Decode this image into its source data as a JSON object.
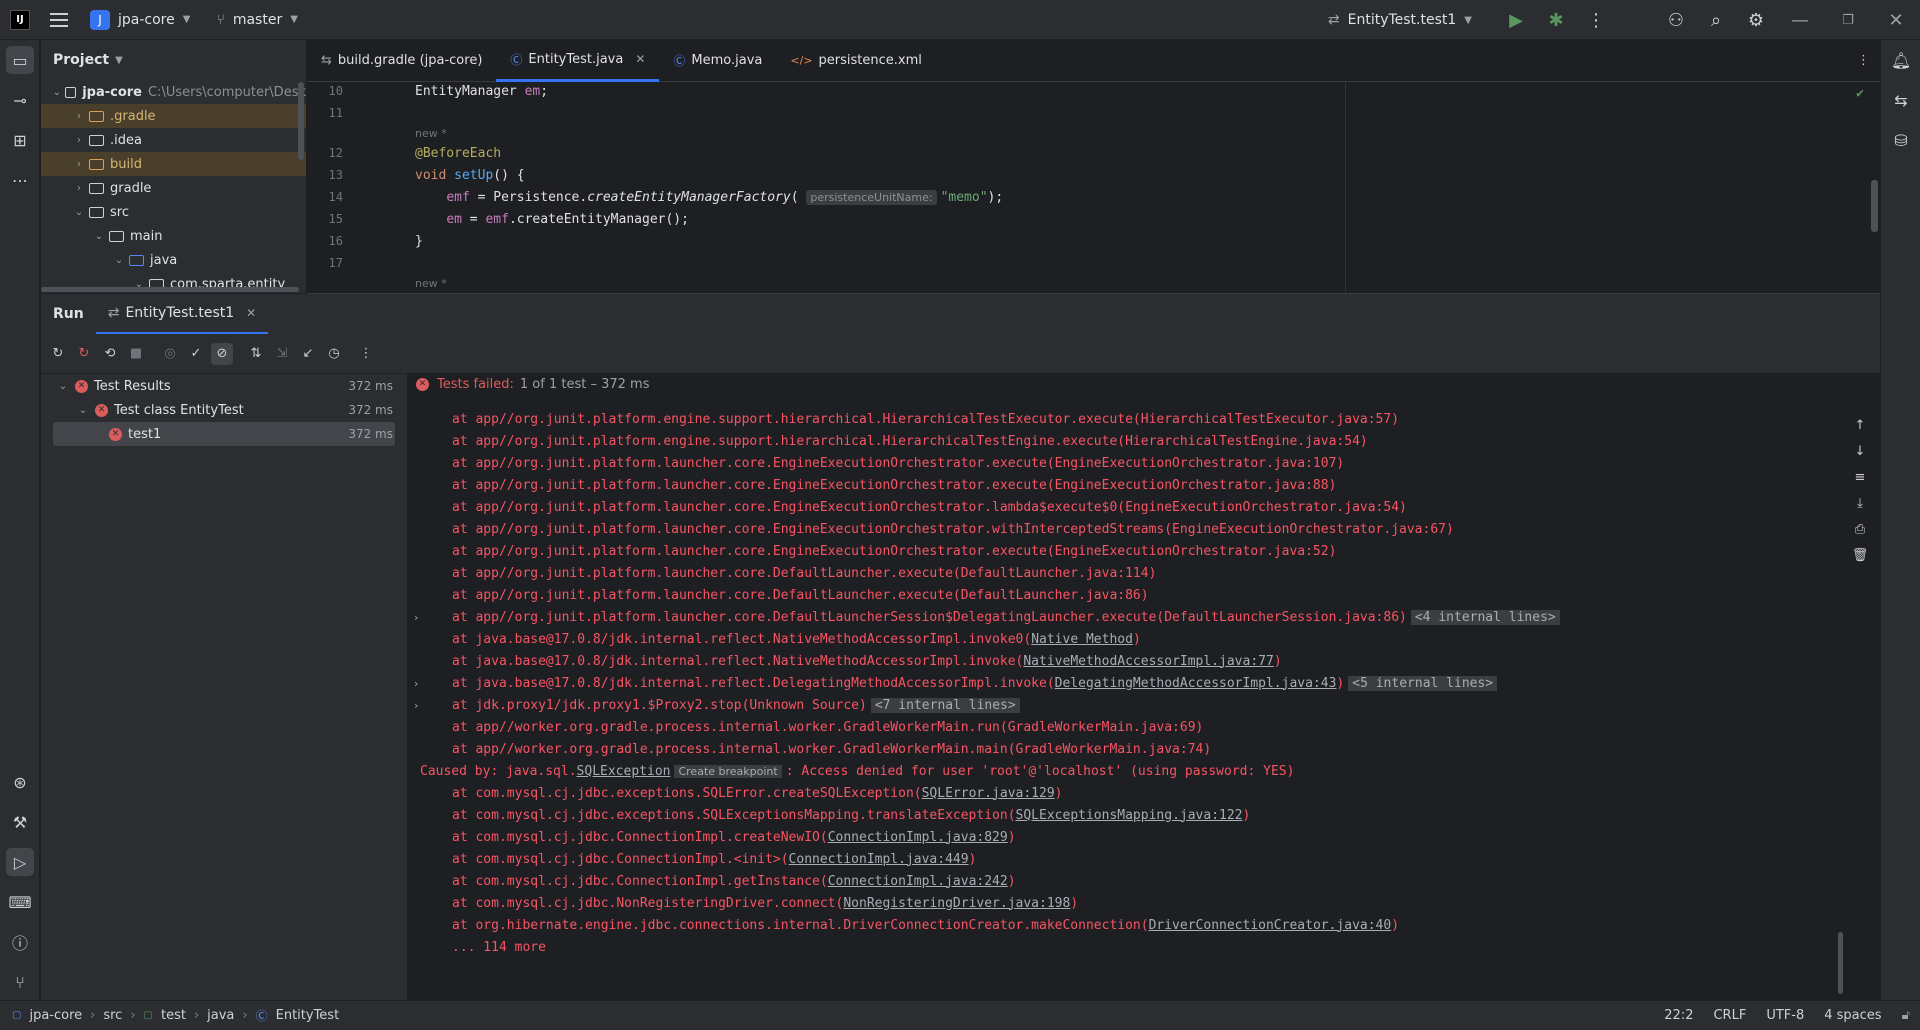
{
  "titlebar": {
    "logo": "IJ",
    "project_badge": "J",
    "project_name": "jpa-core",
    "branch": "master",
    "run_config": "EntityTest.test1"
  },
  "project_panel": {
    "title": "Project",
    "root_name": "jpa-core",
    "root_path": "C:\\Users\\computer\\Desk",
    "items": [
      {
        "label": ".gradle"
      },
      {
        "label": ".idea"
      },
      {
        "label": "build"
      },
      {
        "label": "gradle"
      },
      {
        "label": "src"
      },
      {
        "label": "main"
      },
      {
        "label": "java"
      },
      {
        "label": "com.sparta.entity"
      }
    ]
  },
  "editor_tabs": [
    {
      "label": "build.gradle (jpa-core)"
    },
    {
      "label": "EntityTest.java"
    },
    {
      "label": "Memo.java"
    },
    {
      "label": "persistence.xml"
    }
  ],
  "code": {
    "l10_num": "10",
    "l10_type": "EntityManager",
    "l10_var": "em",
    "l11_num": "11",
    "new_hint": "new *",
    "l12_num": "12",
    "l12_ann": "@BeforeEach",
    "l13_num": "13",
    "l13_kw": "void",
    "l13_fn": "setUp",
    "l14_num": "14",
    "l14_field": "emf",
    "l14_cls": "Persistence",
    "l14_method": "createEntityManagerFactory",
    "l14_hint": "persistenceUnitName:",
    "l14_str": "\"memo\"",
    "l15_num": "15",
    "l15_field": "em",
    "l15_obj": "emf",
    "l15_method": "createEntityManager",
    "l16_num": "16",
    "l17_num": "17"
  },
  "run_panel": {
    "title": "Run",
    "tab": "EntityTest.test1"
  },
  "results": {
    "root": "Test Results",
    "root_ms": "372 ms",
    "cls": "Test class EntityTest",
    "cls_ms": "372 ms",
    "test": "test1",
    "test_ms": "372 ms"
  },
  "console": {
    "status_failed": "Tests failed:",
    "status_detail": "1 of 1 test – 372 ms",
    "l01": "at app//org.junit.platform.engine.support.hierarchical.HierarchicalTestExecutor.execute(HierarchicalTestExecutor.java:57)",
    "l02": "at app//org.junit.platform.engine.support.hierarchical.HierarchicalTestEngine.execute(HierarchicalTestEngine.java:54)",
    "l03": "at app//org.junit.platform.launcher.core.EngineExecutionOrchestrator.execute(EngineExecutionOrchestrator.java:107)",
    "l04": "at app//org.junit.platform.launcher.core.EngineExecutionOrchestrator.execute(EngineExecutionOrchestrator.java:88)",
    "l05": "at app//org.junit.platform.launcher.core.EngineExecutionOrchestrator.lambda$execute$0(EngineExecutionOrchestrator.java:54)",
    "l06": "at app//org.junit.platform.launcher.core.EngineExecutionOrchestrator.withInterceptedStreams(EngineExecutionOrchestrator.java:67)",
    "l07": "at app//org.junit.platform.launcher.core.EngineExecutionOrchestrator.execute(EngineExecutionOrchestrator.java:52)",
    "l08": "at app//org.junit.platform.launcher.core.DefaultLauncher.execute(DefaultLauncher.java:114)",
    "l09": "at app//org.junit.platform.launcher.core.DefaultLauncher.execute(DefaultLauncher.java:86)",
    "l10": "at app//org.junit.platform.launcher.core.DefaultLauncherSession$DelegatingLauncher.execute(DefaultLauncherSession.java:86)",
    "l10_internal": "<4 internal lines>",
    "l11_a": "at java.base@17.0.8/jdk.internal.reflect.NativeMethodAccessorImpl.invoke0(",
    "l11_link": "Native Method",
    "l11_b": ")",
    "l12_a": "at java.base@17.0.8/jdk.internal.reflect.NativeMethodAccessorImpl.invoke(",
    "l12_link": "NativeMethodAccessorImpl.java:77",
    "l12_b": ")",
    "l13_a": "at java.base@17.0.8/jdk.internal.reflect.DelegatingMethodAccessorImpl.invoke(",
    "l13_link": "DelegatingMethodAccessorImpl.java:43",
    "l13_b": ")",
    "l13_internal": "<5 internal lines>",
    "l14": "at jdk.proxy1/jdk.proxy1.$Proxy2.stop(Unknown Source)",
    "l14_internal": "<7 internal lines>",
    "l15": "at app//worker.org.gradle.process.internal.worker.GradleWorkerMain.run(GradleWorkerMain.java:69)",
    "l16": "at app//worker.org.gradle.process.internal.worker.GradleWorkerMain.main(GradleWorkerMain.java:74)",
    "l17_a": "Caused by: java.sql.",
    "l17_link": "SQLException",
    "l17_bp": "Create breakpoint",
    "l17_b": ": Access denied for user 'root'@'localhost' (using password: YES)",
    "l18_a": "at com.mysql.cj.jdbc.exceptions.SQLError.createSQLException(",
    "l18_link": "SQLError.java:129",
    "l18_b": ")",
    "l19_a": "at com.mysql.cj.jdbc.exceptions.SQLExceptionsMapping.translateException(",
    "l19_link": "SQLExceptionsMapping.java:122",
    "l19_b": ")",
    "l20_a": "at com.mysql.cj.jdbc.ConnectionImpl.createNewIO(",
    "l20_link": "ConnectionImpl.java:829",
    "l20_b": ")",
    "l21_a": "at com.mysql.cj.jdbc.ConnectionImpl.<init>(",
    "l21_link": "ConnectionImpl.java:449",
    "l21_b": ")",
    "l22_a": "at com.mysql.cj.jdbc.ConnectionImpl.getInstance(",
    "l22_link": "ConnectionImpl.java:242",
    "l22_b": ")",
    "l23_a": "at com.mysql.cj.jdbc.NonRegisteringDriver.connect(",
    "l23_link": "NonRegisteringDriver.java:198",
    "l23_b": ")",
    "l24_a": "at org.hibernate.engine.jdbc.connections.internal.DriverConnectionCreator.makeConnection(",
    "l24_link": "DriverConnectionCreator.java:40",
    "l24_b": ")",
    "l25": "... 114 more"
  },
  "statusbar": {
    "crumbs": [
      "jpa-core",
      "src",
      "test",
      "java",
      "EntityTest"
    ],
    "position": "22:2",
    "line_sep": "CRLF",
    "encoding": "UTF-8",
    "indent": "4 spaces"
  }
}
